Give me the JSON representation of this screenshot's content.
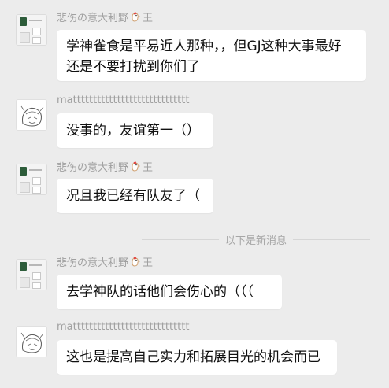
{
  "divider": {
    "label": "以下是新消息"
  },
  "messages": [
    {
      "sender": "悲伤の意大利野",
      "sender_suffix": "王",
      "avatar": "collage-avatar",
      "lines": [
        "学神雀食是平易近人那种，，但GJ这种大事最好",
        "还是不要打扰到你们了"
      ]
    },
    {
      "sender": "mattttttttttttttttttttttttttttt",
      "sender_suffix": "",
      "avatar": "sketch-avatar",
      "lines": [
        "没事的，友谊第一（）"
      ]
    },
    {
      "sender": "悲伤の意大利野",
      "sender_suffix": "王",
      "avatar": "collage-avatar",
      "lines": [
        "况且我已经有队友了（"
      ]
    },
    {
      "sender": "悲伤の意大利野",
      "sender_suffix": "王",
      "avatar": "collage-avatar",
      "lines": [
        "去学神队的话他们会伤心的（（（"
      ]
    },
    {
      "sender": "mattttttttttttttttttttttttttttt",
      "sender_suffix": "",
      "avatar": "sketch-avatar",
      "lines": [
        "这也是提高自己实力和拓展目光的机会而已"
      ]
    }
  ]
}
